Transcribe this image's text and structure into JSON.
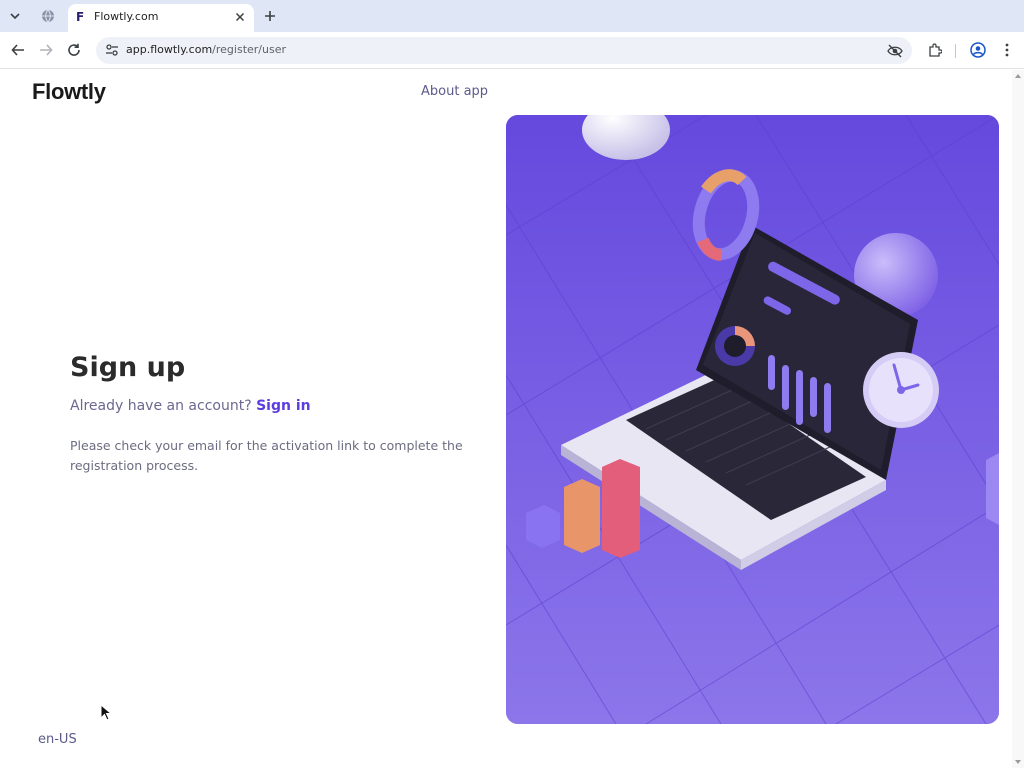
{
  "browser": {
    "tab_title": "Flowtly.com",
    "tab_favicon_letter": "F",
    "url_host": "app.flowtly.com",
    "url_path": "/register/user"
  },
  "header": {
    "logo_text": "Flowtly",
    "about_label": "About app"
  },
  "main": {
    "title": "Sign up",
    "have_account_text": "Already have an account?",
    "signin_label": "Sign in",
    "notice": "Please check your email for the activation link to complete the registration process."
  },
  "footer": {
    "locale": "en-US"
  },
  "colors": {
    "brand": "#5b3de0",
    "hero_bg": "#6a4fe0",
    "link": "#5b5a8a"
  },
  "icons": {
    "tab_menu": "chevron-down-icon",
    "ghost_tab": "globe-icon",
    "close": "close-icon",
    "new_tab": "plus-icon",
    "back": "arrow-left-icon",
    "forward": "arrow-right-icon",
    "reload": "reload-icon",
    "site_info": "tune-icon",
    "eye_off": "eye-off-icon",
    "extensions": "puzzle-icon",
    "profile": "profile-icon",
    "menu": "more-vert-icon"
  }
}
